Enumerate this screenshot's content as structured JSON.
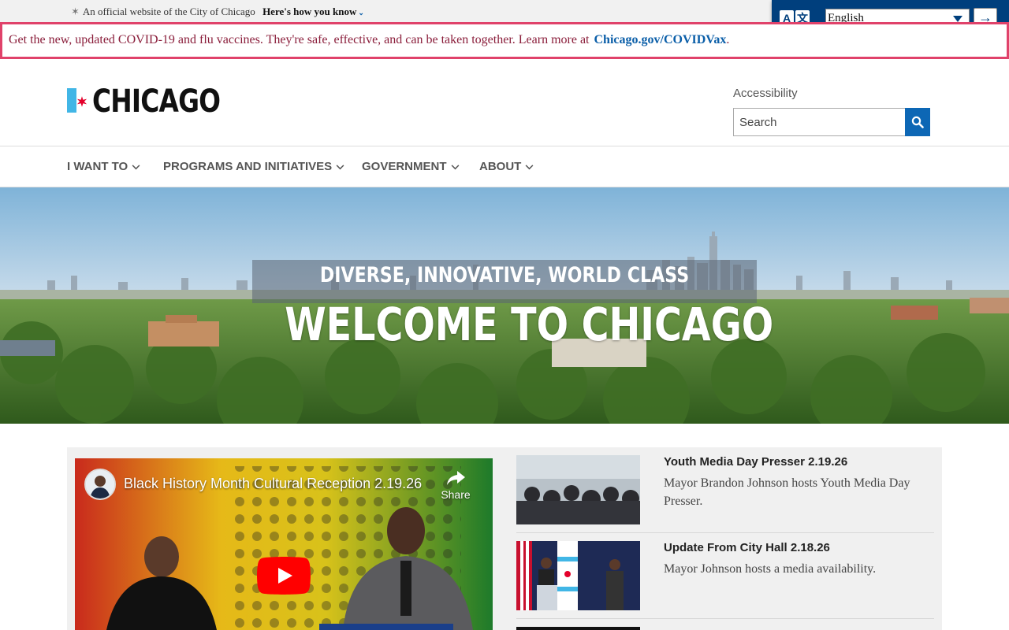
{
  "official_banner": {
    "text": "An official website of the City of Chicago",
    "link": "Here's how you know"
  },
  "translate": {
    "icon": "translate-icon",
    "selected_language": "English",
    "go_icon": "arrow-right-icon"
  },
  "alert": {
    "text": "Get the new, updated COVID-19 and flu vaccines. They're safe, effective, and can be taken together. Learn more at",
    "link": "Chicago.gov/COVIDVax",
    "tail": "."
  },
  "header": {
    "logo_text": "CHICAGO",
    "accessibility_label": "Accessibility",
    "search_placeholder": "Search",
    "search_icon": "search-icon"
  },
  "nav": {
    "items": [
      {
        "label": "I WANT TO"
      },
      {
        "label": "PROGRAMS AND INITIATIVES"
      },
      {
        "label": "GOVERNMENT"
      },
      {
        "label": "ABOUT"
      }
    ]
  },
  "hero": {
    "subtitle": "DIVERSE, INNOVATIVE, WORLD CLASS",
    "title": "WELCOME TO CHICAGO"
  },
  "video": {
    "title": "Black History Month Cultural Reception 2.19.26",
    "share_label": "Share"
  },
  "news": [
    {
      "title": "Youth Media Day Presser 2.19.26",
      "description": "Mayor Brandon Johnson hosts Youth Media Day Presser."
    },
    {
      "title": "Update From City Hall 2.18.26",
      "description": "Mayor Johnson hosts a media availability."
    }
  ],
  "colors": {
    "brand_blue": "#41b6e6",
    "brand_red": "#e4002b",
    "alert_border": "#e0426a",
    "link_blue": "#0a5ea8",
    "translate_bg": "#003f7d",
    "search_button": "#0d67b5"
  }
}
